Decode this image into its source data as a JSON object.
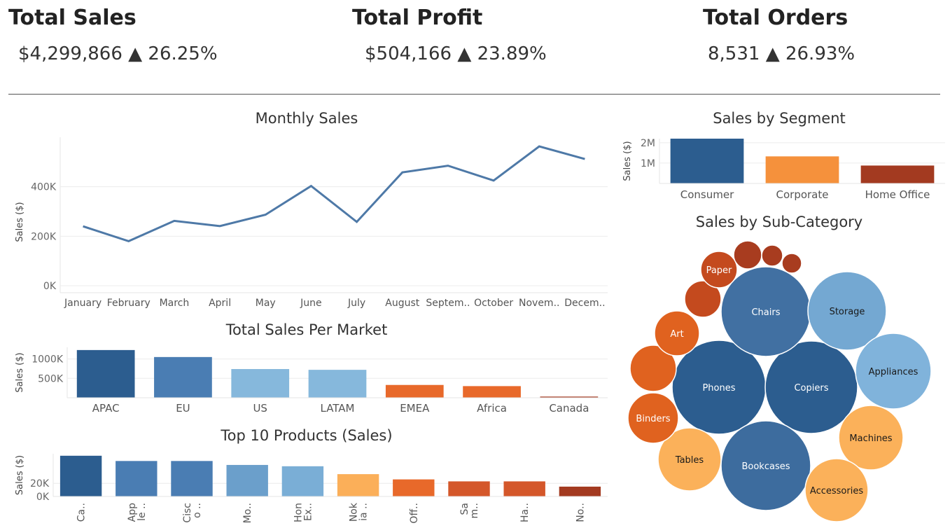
{
  "kpis": [
    {
      "title": "Total Sales",
      "value": "$4,299,866",
      "arrow": "▲",
      "change": "26.25%"
    },
    {
      "title": "Total Profit",
      "value": "$504,166",
      "arrow": "▲",
      "change": "23.89%"
    },
    {
      "title": "Total Orders",
      "value": "8,531",
      "arrow": "▲",
      "change": "26.93%"
    }
  ],
  "colors": {
    "line": "#4e79a7",
    "grid": "#ececec",
    "axis": "#666666",
    "blue_dark": "#2c5d8f",
    "blue_mid": "#4a7db3",
    "blue_light": "#86b8dc",
    "orange_light": "#fbaf59",
    "orange": "#e8692a",
    "red_brown": "#a33a20"
  },
  "chart_data": [
    {
      "id": "monthly",
      "type": "line",
      "title": "Monthly Sales",
      "ylabel": "Sales ($)",
      "categories": [
        "January",
        "February",
        "March",
        "April",
        "May",
        "June",
        "July",
        "August",
        "Septem..",
        "October",
        "Novem..",
        "Decem.."
      ],
      "values": [
        240000,
        180000,
        262000,
        241000,
        287000,
        403000,
        258000,
        458000,
        485000,
        425000,
        563000,
        512000
      ],
      "ylim": [
        0,
        600000
      ],
      "yticks": [
        0,
        200000,
        400000
      ],
      "ytick_labels": [
        "0K",
        "200K",
        "400K"
      ],
      "grid": true
    },
    {
      "id": "market",
      "type": "bar",
      "title": "Total Sales Per Market",
      "ylabel": "Sales ($)",
      "categories": [
        "APAC",
        "EU",
        "US",
        "LATAM",
        "EMEA",
        "Africa",
        "Canada"
      ],
      "values": [
        1230000,
        1050000,
        740000,
        720000,
        330000,
        300000,
        30000
      ],
      "bar_colors": [
        "#2c5d8f",
        "#4a7db3",
        "#86b8dc",
        "#86b8dc",
        "#e8692a",
        "#e8692a",
        "#a33a20"
      ],
      "ylim": [
        0,
        1300000
      ],
      "yticks": [
        500000,
        1000000
      ],
      "ytick_labels": [
        "500K",
        "1000K"
      ]
    },
    {
      "id": "products",
      "type": "bar",
      "title": "Top 10  Products (Sales)",
      "ylabel": "Sales ($)",
      "categories": [
        [
          "Ca.."
        ],
        [
          "App",
          "le .."
        ],
        [
          "Cisc",
          "o .."
        ],
        [
          "Mo.."
        ],
        [
          "Hon",
          "Ex.."
        ],
        [
          "Nok",
          "ia .."
        ],
        [
          "Off.."
        ],
        [
          "Sa",
          "m.."
        ],
        [
          "Ha.."
        ],
        [
          "No.."
        ]
      ],
      "values": [
        62000,
        54000,
        54000,
        48000,
        46000,
        34000,
        26000,
        23000,
        23000,
        15000
      ],
      "bar_colors": [
        "#2c5d8f",
        "#4a7db3",
        "#4a7db3",
        "#6b9fcb",
        "#7aaed6",
        "#fbaf59",
        "#e8692a",
        "#d4572a",
        "#d4572a",
        "#a33a20"
      ],
      "ylim": [
        0,
        65000
      ],
      "yticks": [
        0,
        20000
      ],
      "ytick_labels": [
        "0K",
        "20K"
      ]
    },
    {
      "id": "segment",
      "type": "bar",
      "title": "Sales by Segment",
      "ylabel": "Sales ($)",
      "categories": [
        "Consumer",
        "Corporate",
        "Home Office"
      ],
      "values": [
        2200000,
        1330000,
        880000
      ],
      "bar_colors": [
        "#2c5d8f",
        "#f5913c",
        "#a33a20"
      ],
      "ylim": [
        0,
        2200000
      ],
      "yticks": [
        1000000,
        2000000
      ],
      "ytick_labels": [
        "1M",
        "2M"
      ]
    },
    {
      "id": "subcategory",
      "type": "bubble",
      "title": "Sales by Sub-Category",
      "bubbles": [
        {
          "label": "Phones",
          "value": 670000,
          "color": "#2c5d8f",
          "text_color": "#ffffff"
        },
        {
          "label": "Copiers",
          "value": 660000,
          "color": "#2c5d8f",
          "text_color": "#ffffff"
        },
        {
          "label": "Chairs",
          "value": 620000,
          "color": "#4170a2",
          "text_color": "#ffffff"
        },
        {
          "label": "Bookcases",
          "value": 610000,
          "color": "#3d6c9e",
          "text_color": "#ffffff"
        },
        {
          "label": "Storage",
          "value": 480000,
          "color": "#74a8d2",
          "text_color": "#1a1a1a"
        },
        {
          "label": "Appliances",
          "value": 430000,
          "color": "#80b3db",
          "text_color": "#1a1a1a"
        },
        {
          "label": "Machines",
          "value": 310000,
          "color": "#fbb15a",
          "text_color": "#1a1a1a"
        },
        {
          "label": "Tables",
          "value": 300000,
          "color": "#fbb15a",
          "text_color": "#1a1a1a"
        },
        {
          "label": "Accessories",
          "value": 290000,
          "color": "#fbb15a",
          "text_color": "#1a1a1a"
        },
        {
          "label": "Binders",
          "value": 190000,
          "color": "#e0621f",
          "text_color": "#ffffff"
        },
        {
          "label": "",
          "value": 160000,
          "color": "#e0621f",
          "text_color": "#ffffff"
        },
        {
          "label": "Art",
          "value": 150000,
          "color": "#e0621f",
          "text_color": "#ffffff"
        },
        {
          "label": "",
          "value": 110000,
          "color": "#c44a1e",
          "text_color": "#ffffff"
        },
        {
          "label": "Paper",
          "value": 100000,
          "color": "#c44a1e",
          "text_color": "#ffffff"
        },
        {
          "label": "",
          "value": 60000,
          "color": "#a83c1f",
          "text_color": "#ffffff"
        },
        {
          "label": "",
          "value": 30000,
          "color": "#a83c1f",
          "text_color": "#ffffff"
        },
        {
          "label": "",
          "value": 28000,
          "color": "#a83c1f",
          "text_color": "#ffffff"
        }
      ]
    }
  ]
}
